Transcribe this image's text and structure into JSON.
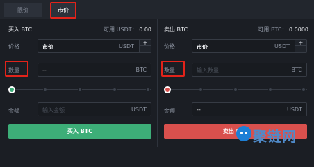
{
  "tabs": [
    {
      "label": "限价",
      "active": false
    },
    {
      "label": "市价",
      "active": true
    }
  ],
  "buy": {
    "title": "买入 BTC",
    "avail_label": "可用 USDT：",
    "avail_value": "0.00",
    "price_label": "价格",
    "price_value": "市价",
    "price_unit": "USDT",
    "amount_label": "数量",
    "amount_value": "--",
    "amount_unit": "BTC",
    "total_label": "金额",
    "total_placeholder": "输入金额",
    "total_unit": "USDT",
    "slider_fraction": 0,
    "button_label": "买入 BTC"
  },
  "sell": {
    "title": "卖出 BTC",
    "avail_label": "可用 BTC：",
    "avail_value": "0.0000",
    "price_label": "价格",
    "price_value": "市价",
    "price_unit": "USDT",
    "amount_label": "数量",
    "amount_placeholder": "输入数量",
    "amount_unit": "BTC",
    "total_label": "金额",
    "total_value": "--",
    "total_unit": "USDT",
    "slider_fraction": 0,
    "button_label": "卖出 BTC"
  },
  "stepper": {
    "plus": "+",
    "minus": "−"
  },
  "watermark": {
    "text": "聚链网"
  },
  "colors": {
    "buy": "#3dae78",
    "sell": "#d9504d",
    "highlight_box": "#e2231a",
    "background": "#1b1e24"
  }
}
